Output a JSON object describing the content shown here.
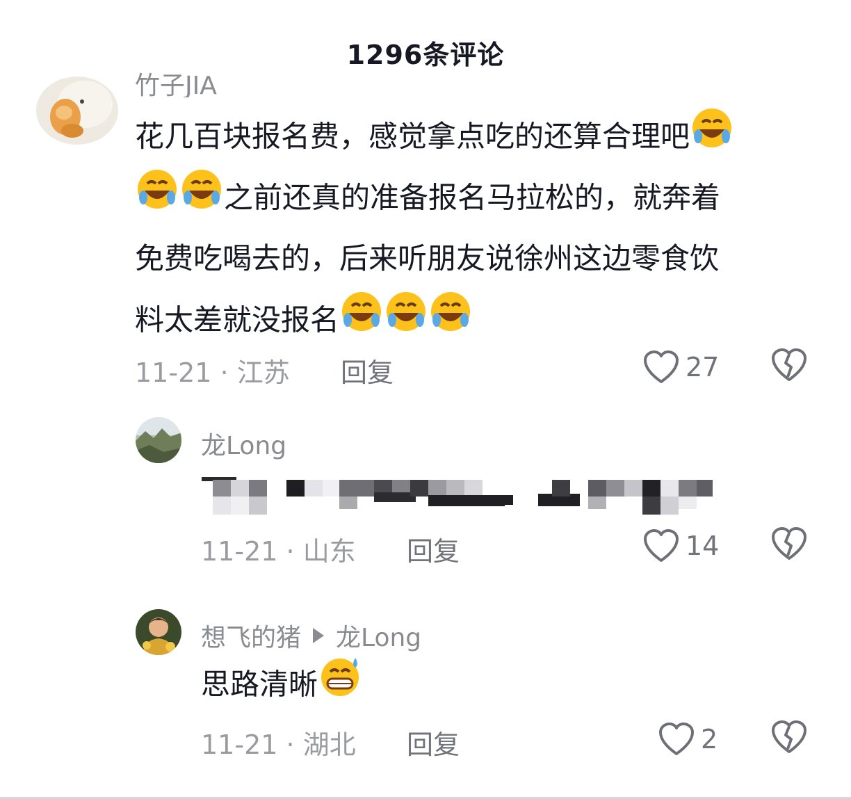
{
  "header": {
    "title": "1296条评论"
  },
  "comments": [
    {
      "username": "竹子JIA",
      "text_line1": "花几百块报名费，感觉拿点吃的还算合理吧",
      "text_line2": "之前还真的准备报名马拉松的，就奔着",
      "text_line3": "免费吃喝去的，后来听朋友说徐州这边零食饮",
      "text_line4": "料太差就没报名",
      "date": "11-21",
      "location": "江苏",
      "reply_label": "回复",
      "likes": "27"
    },
    {
      "username": "龙Long",
      "date": "11-21",
      "location": "山东",
      "reply_label": "回复",
      "likes": "14"
    },
    {
      "username": "想飞的猪",
      "reply_to": "龙Long",
      "text": "思路清晰",
      "date": "11-21",
      "location": "湖北",
      "reply_label": "回复",
      "likes": "2"
    }
  ],
  "icons": {
    "like": "heart-outline-icon",
    "dislike": "broken-heart-icon",
    "reply_arrow": "triangle-right-icon",
    "emoji_laugh": "rofl-emoji",
    "emoji_grin": "grin-sweat-emoji"
  },
  "colors": {
    "text": "#161823",
    "muted": "#9a9ba1",
    "emoji": "#fcc21b"
  }
}
